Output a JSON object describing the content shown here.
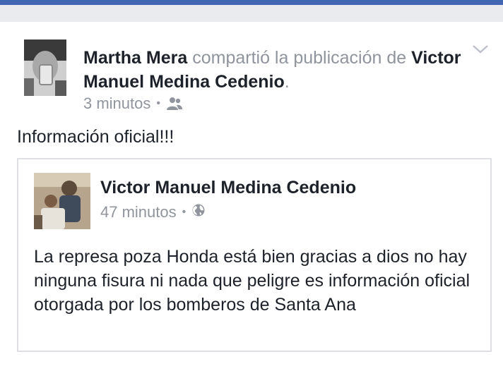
{
  "post": {
    "author": "Martha Mera",
    "action_text": "compartió la publicación de",
    "shared_from": "Victor Manuel Medina Cedenio",
    "period": ".",
    "time": "3 minutos",
    "audience_icon": "friends-icon",
    "text": "Información oficial!!!"
  },
  "shared_post": {
    "author": "Victor Manuel Medina Cedenio",
    "time": "47 minutos",
    "audience_icon": "globe-icon",
    "text": "La represa poza Honda está bien gracias a dios no hay ninguna fisura ni nada que peligre es información oficial otorgada por los bomberos de Santa Ana"
  },
  "colors": {
    "brand": "#4267b2",
    "text": "#1d2129",
    "secondary": "#90949c",
    "border": "#dddfe2"
  }
}
